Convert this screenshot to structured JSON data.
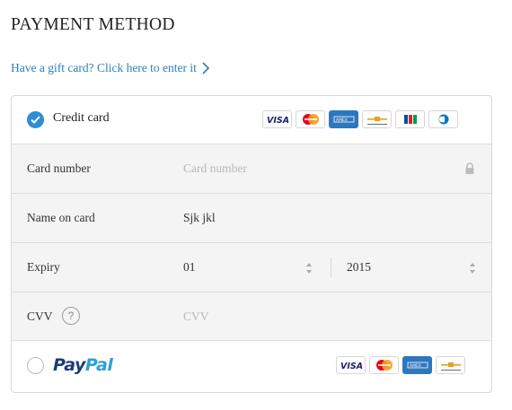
{
  "heading": "PAYMENT METHOD",
  "gift_link": "Have a gift card? Click here to enter it",
  "credit_card": {
    "label": "Credit card",
    "selected": true,
    "brands": [
      "visa",
      "mastercard",
      "amex",
      "card-generic",
      "jcb",
      "diners"
    ]
  },
  "fields": {
    "card_number": {
      "label": "Card number",
      "placeholder": "Card number",
      "value": ""
    },
    "name_on_card": {
      "label": "Name on card",
      "value": "Sjk jkl"
    },
    "expiry": {
      "label": "Expiry",
      "month": "01",
      "year": "2015"
    },
    "cvv": {
      "label": "CVV",
      "help": "?",
      "placeholder": "CVV",
      "value": ""
    }
  },
  "paypal": {
    "label_part1": "Pay",
    "label_part2": "Pal",
    "selected": false,
    "brands": [
      "visa",
      "mastercard",
      "amex",
      "card-generic"
    ]
  },
  "colors": {
    "accent": "#2d8dd6",
    "link": "#2b7fb8",
    "field_bg": "#f4f4f4",
    "paypal_dark": "#1d3a7a",
    "paypal_light": "#2a9fdc"
  }
}
